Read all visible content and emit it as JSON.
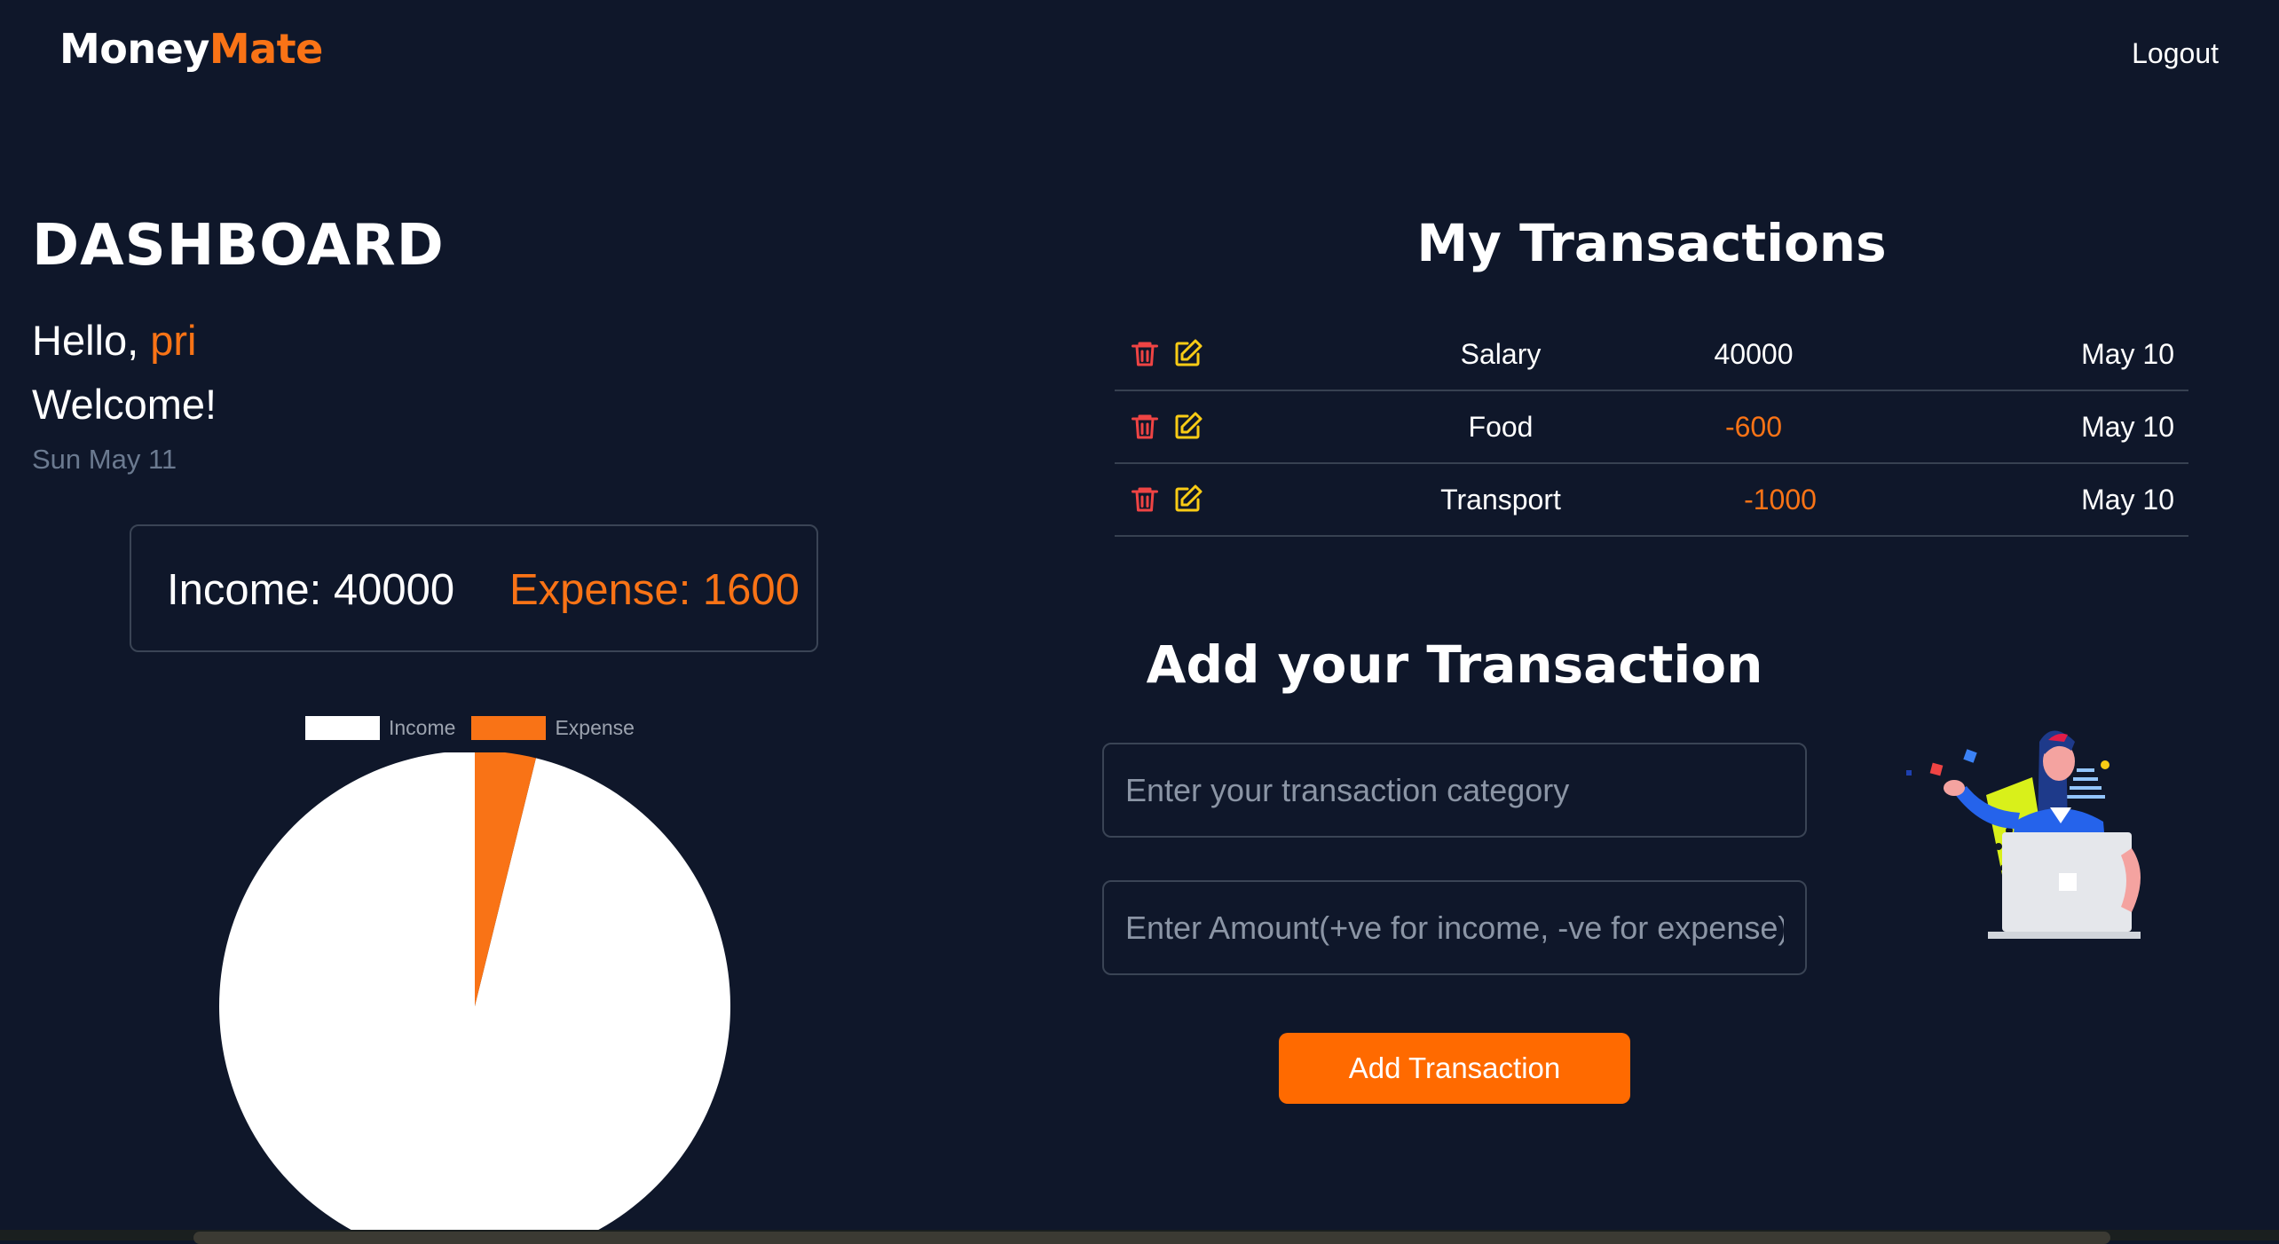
{
  "brand": {
    "part1": "Money",
    "part2": "Mate"
  },
  "nav": {
    "logout": "Logout"
  },
  "dashboard": {
    "title": "DASHBOARD",
    "hello_prefix": "Hello, ",
    "user_name": "pri",
    "welcome": "Welcome!",
    "date": "Sun May 11",
    "income_label": "Income: 40000",
    "expense_label": "Expense: 1600"
  },
  "chart_data": {
    "type": "pie",
    "categories": [
      "Income",
      "Expense"
    ],
    "values": [
      40000,
      1600
    ],
    "colors": [
      "#ffffff",
      "#f97316"
    ],
    "legend_position": "top"
  },
  "transactions": {
    "title": "My Transactions",
    "rows": [
      {
        "category": "Salary",
        "amount": "40000",
        "date": "May 10",
        "negative": false
      },
      {
        "category": "Food",
        "amount": "-600",
        "date": "May 10",
        "negative": true
      },
      {
        "category": "Transport",
        "amount": "-1000",
        "date": "May 10",
        "negative": true
      }
    ],
    "icons": {
      "delete": "trash-icon",
      "edit": "edit-icon"
    }
  },
  "add_form": {
    "title": "Add your Transaction",
    "category_placeholder": "Enter your transaction category",
    "amount_placeholder": "Enter Amount(+ve for income, -ve for expense)",
    "submit_label": "Add Transaction"
  },
  "colors": {
    "background": "#0f172a",
    "accent": "#f97316",
    "button": "#ff6a00",
    "delete_icon": "#ef4444",
    "edit_icon": "#facc15"
  }
}
